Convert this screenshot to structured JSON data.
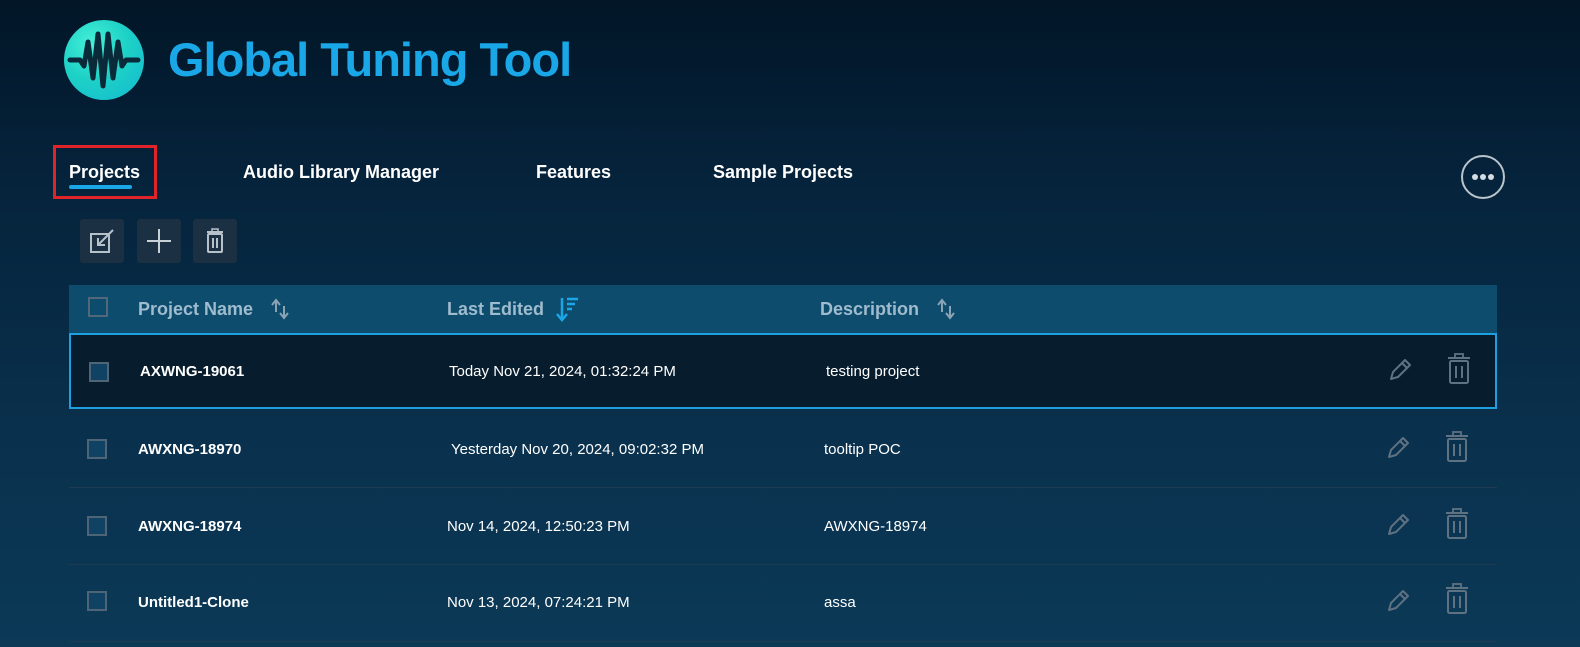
{
  "app": {
    "title": "Global Tuning Tool",
    "logo_icon": "waveform-icon",
    "accent_color": "#1aa7e8"
  },
  "tabs": [
    {
      "label": "Projects",
      "active": true
    },
    {
      "label": "Audio Library Manager",
      "active": false
    },
    {
      "label": "Features",
      "active": false
    },
    {
      "label": "Sample Projects",
      "active": false
    }
  ],
  "toolbar": {
    "import_icon": "import-icon",
    "add_icon": "plus-icon",
    "delete_icon": "trash-icon",
    "more_icon": "more-horizontal-icon"
  },
  "table": {
    "columns": [
      {
        "label": "Project Name",
        "sort": "none",
        "sort_icon": "sort-icon"
      },
      {
        "label": "Last Edited",
        "sort": "descending",
        "sort_icon": "sort-descending-icon"
      },
      {
        "label": "Description",
        "sort": "none",
        "sort_icon": "sort-icon"
      }
    ],
    "rows": [
      {
        "name": "AXWNG-19061",
        "last_edited": "Today Nov 21, 2024, 01:32:24 PM",
        "description": "testing project",
        "selected": true
      },
      {
        "name": "AWXNG-18970",
        "last_edited": "Yesterday Nov 20, 2024, 09:02:32 PM",
        "description": "tooltip POC",
        "selected": false
      },
      {
        "name": "AWXNG-18974",
        "last_edited": "Nov 14, 2024, 12:50:23 PM",
        "description": "AWXNG-18974",
        "selected": false
      },
      {
        "name": "Untitled1-Clone",
        "last_edited": "Nov 13, 2024, 07:24:21 PM",
        "description": "assa",
        "selected": false
      }
    ]
  }
}
